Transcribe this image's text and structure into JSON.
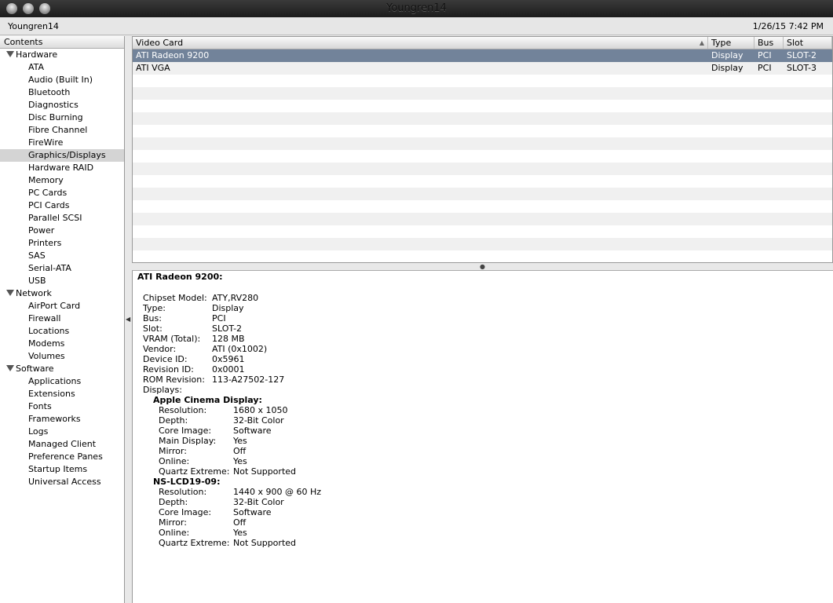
{
  "window": {
    "title": "Youngren14"
  },
  "toolbar": {
    "machine": "Youngren14",
    "datetime": "1/26/15 7:42 PM"
  },
  "sidebar": {
    "header": "Contents",
    "groups": [
      {
        "label": "Hardware",
        "items": [
          "ATA",
          "Audio (Built In)",
          "Bluetooth",
          "Diagnostics",
          "Disc Burning",
          "Fibre Channel",
          "FireWire",
          "Graphics/Displays",
          "Hardware RAID",
          "Memory",
          "PC Cards",
          "PCI Cards",
          "Parallel SCSI",
          "Power",
          "Printers",
          "SAS",
          "Serial-ATA",
          "USB"
        ]
      },
      {
        "label": "Network",
        "items": [
          "AirPort Card",
          "Firewall",
          "Locations",
          "Modems",
          "Volumes"
        ]
      },
      {
        "label": "Software",
        "items": [
          "Applications",
          "Extensions",
          "Fonts",
          "Frameworks",
          "Logs",
          "Managed Client",
          "Preference Panes",
          "Startup Items",
          "Universal Access"
        ]
      }
    ],
    "selected": "Graphics/Displays"
  },
  "table": {
    "columns": [
      "Video Card",
      "Type",
      "Bus",
      "Slot"
    ],
    "rows": [
      [
        "ATI Radeon 9200",
        "Display",
        "PCI",
        "SLOT-2"
      ],
      [
        "ATI VGA",
        "Display",
        "PCI",
        "SLOT-3"
      ]
    ]
  },
  "detail": {
    "title": "ATI Radeon 9200:",
    "fields": [
      [
        "Chipset Model:",
        "ATY,RV280"
      ],
      [
        "Type:",
        "Display"
      ],
      [
        "Bus:",
        "PCI"
      ],
      [
        "Slot:",
        "SLOT-2"
      ],
      [
        "VRAM (Total):",
        "128 MB"
      ],
      [
        "Vendor:",
        "ATI (0x1002)"
      ],
      [
        "Device ID:",
        "0x5961"
      ],
      [
        "Revision ID:",
        "0x0001"
      ],
      [
        "ROM Revision:",
        "113-A27502-127"
      ],
      [
        "Displays:",
        ""
      ]
    ],
    "displays": [
      {
        "name": "Apple Cinema Display:",
        "fields": [
          [
            "Resolution:",
            "1680 x 1050"
          ],
          [
            "Depth:",
            "32-Bit Color"
          ],
          [
            "Core Image:",
            "Software"
          ],
          [
            "Main Display:",
            "Yes"
          ],
          [
            "Mirror:",
            "Off"
          ],
          [
            "Online:",
            "Yes"
          ],
          [
            "Quartz Extreme:",
            "Not Supported"
          ]
        ]
      },
      {
        "name": "NS-LCD19-09:",
        "fields": [
          [
            "Resolution:",
            "1440 x 900 @ 60 Hz"
          ],
          [
            "Depth:",
            "32-Bit Color"
          ],
          [
            "Core Image:",
            "Software"
          ],
          [
            "Mirror:",
            "Off"
          ],
          [
            "Online:",
            "Yes"
          ],
          [
            "Quartz Extreme:",
            "Not Supported"
          ]
        ]
      }
    ]
  }
}
